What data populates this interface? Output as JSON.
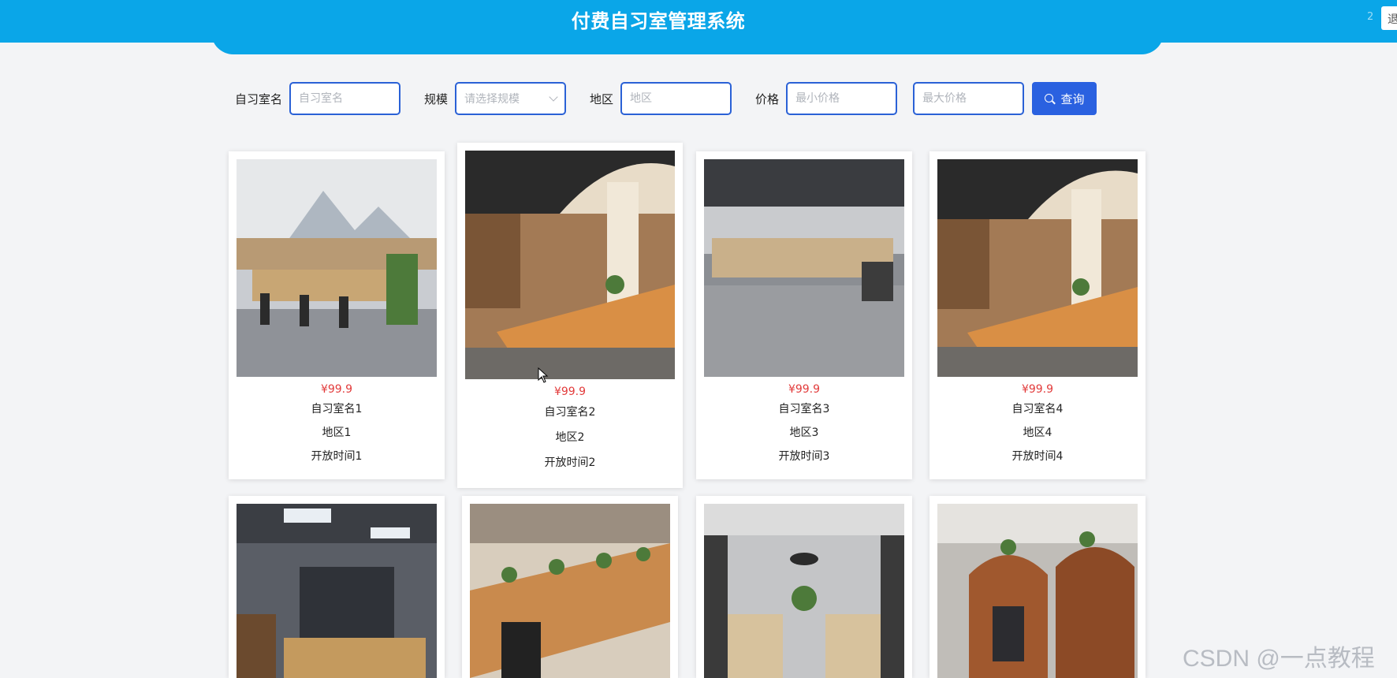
{
  "app": {
    "title": "付费自习室管理系统",
    "header_count": "2",
    "header_button_label": "退"
  },
  "search": {
    "name_label": "自习室名",
    "name_placeholder": "自习室名",
    "scale_label": "规模",
    "scale_placeholder": "请选择规模",
    "region_label": "地区",
    "region_placeholder": "地区",
    "price_label": "价格",
    "min_price_placeholder": "最小价格",
    "max_price_placeholder": "最大价格",
    "query_button_label": "查询"
  },
  "cards": [
    {
      "price": "¥99.9",
      "name": "自习室名1",
      "region": "地区1",
      "open_time": "开放时间1",
      "photo": "study-room-mountain-mural"
    },
    {
      "price": "¥99.9",
      "name": "自习室名2",
      "region": "地区2",
      "open_time": "开放时间2",
      "photo": "study-room-wooden-library"
    },
    {
      "price": "¥99.9",
      "name": "自习室名3",
      "region": "地区3",
      "open_time": "开放时间3",
      "photo": "study-room-grey-cubicles"
    },
    {
      "price": "¥99.9",
      "name": "自习室名4",
      "region": "地区4",
      "open_time": "开放时间4",
      "photo": "study-room-wooden-library"
    },
    {
      "photo": "study-room-cafe-loft"
    },
    {
      "photo": "study-room-desk-rows-plants"
    },
    {
      "photo": "study-room-corridor-pendants"
    },
    {
      "photo": "study-room-wooden-pods"
    }
  ],
  "watermark": "CSDN @一点教程",
  "colors": {
    "header": "#0aa6e8",
    "accent": "#2a61e0",
    "price": "#e23b3b",
    "background": "#f3f4f6"
  }
}
